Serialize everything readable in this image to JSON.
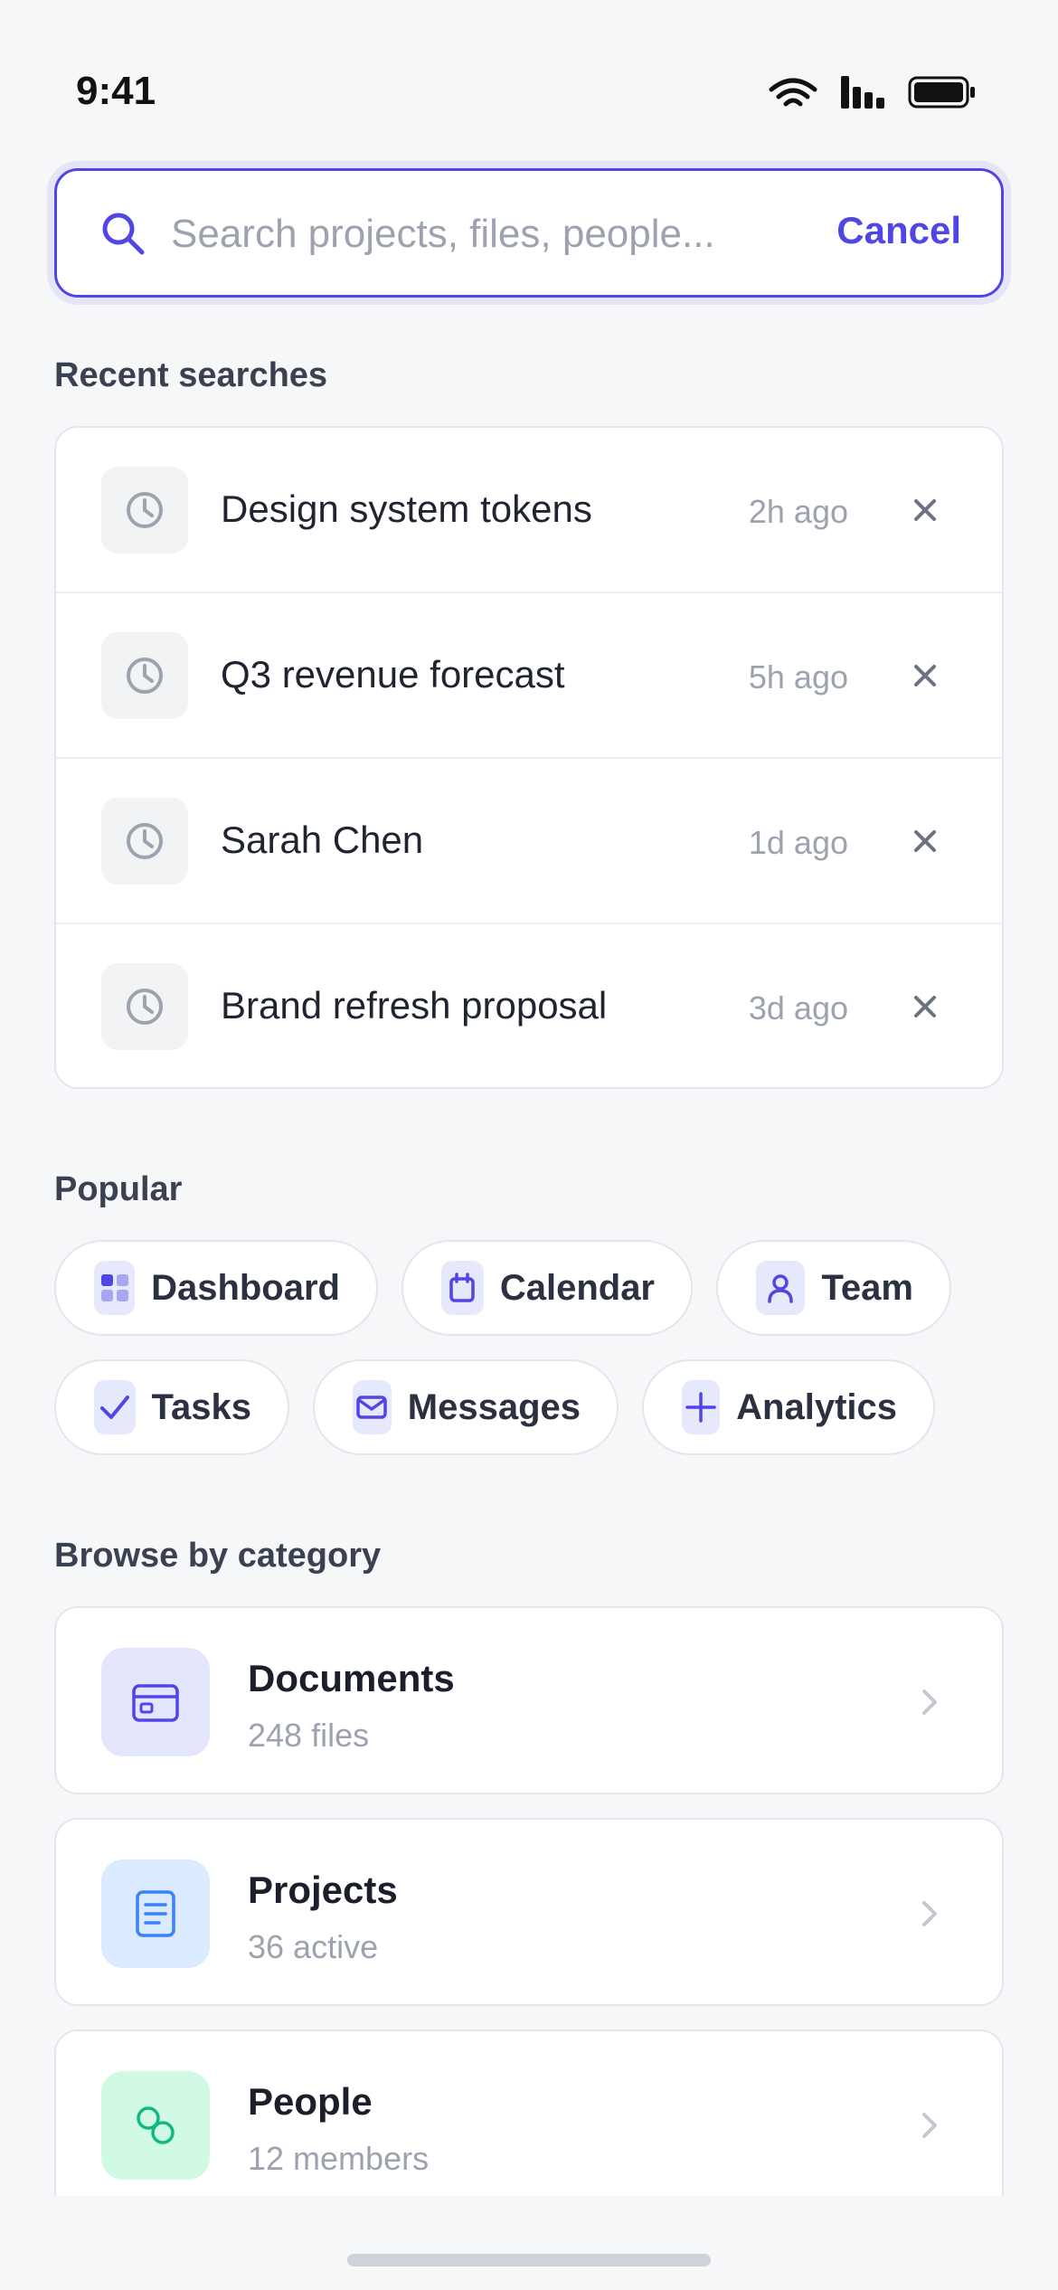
{
  "status_bar": {
    "time": "9:41"
  },
  "search": {
    "placeholder": "Search projects, files, people...",
    "value": "",
    "cancel_label": "Cancel"
  },
  "recent": {
    "title": "Recent searches",
    "items": [
      {
        "label": "Design system tokens",
        "time": "2h ago"
      },
      {
        "label": "Q3 revenue forecast",
        "time": "5h ago"
      },
      {
        "label": "Sarah Chen",
        "time": "1d ago"
      },
      {
        "label": "Brand refresh proposal",
        "time": "3d ago"
      }
    ]
  },
  "popular": {
    "title": "Popular",
    "chips": [
      {
        "label": "Dashboard",
        "icon": "grid-icon"
      },
      {
        "label": "Calendar",
        "icon": "calendar-icon"
      },
      {
        "label": "Team",
        "icon": "user-icon"
      },
      {
        "label": "Tasks",
        "icon": "check-icon"
      },
      {
        "label": "Messages",
        "icon": "mail-icon"
      },
      {
        "label": "Analytics",
        "icon": "plus-icon"
      }
    ]
  },
  "categories": {
    "title": "Browse by category",
    "items": [
      {
        "name": "Documents",
        "sub": "248 files",
        "icon": "card-icon",
        "tint": "#e3e6fc",
        "color": "#4f46e5"
      },
      {
        "name": "Projects",
        "sub": "36 active",
        "icon": "document-icon",
        "tint": "#dbeafe",
        "color": "#3b82f6"
      },
      {
        "name": "People",
        "sub": "12 members",
        "icon": "people-icon",
        "tint": "#d1fae5",
        "color": "#10b981"
      }
    ]
  },
  "colors": {
    "accent": "#4f46e5",
    "muted": "#9ca3af",
    "background": "#f6f7f9"
  }
}
